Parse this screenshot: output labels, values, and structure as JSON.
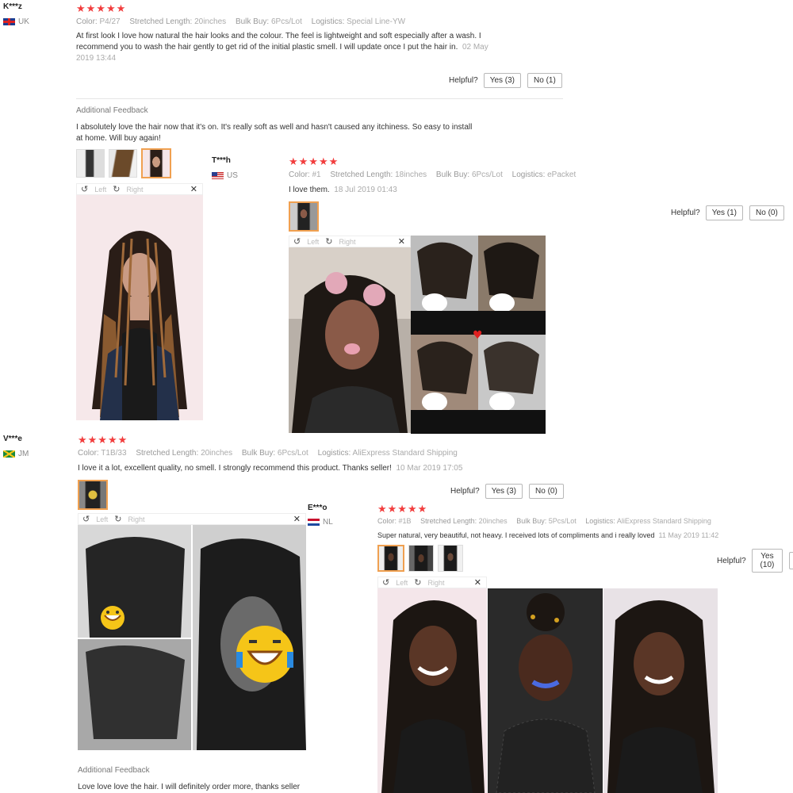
{
  "labels": {
    "color": "Color:",
    "length": "Stretched Length:",
    "bulk": "Bulk Buy:",
    "logistics": "Logistics:",
    "helpful": "Helpful?",
    "left": "Left",
    "right": "Right",
    "additional_feedback": "Additional Feedback"
  },
  "icons": [
    "star-icon",
    "rotate-left-icon",
    "rotate-right-icon",
    "close-icon",
    "flag-icon"
  ],
  "reviews": [
    {
      "user": "K***z",
      "country": "UK",
      "stars": "★★★★★",
      "color": "P4/27",
      "length": "20inches",
      "bulk": "6Pcs/Lot",
      "logistics": "Special Line-YW",
      "text_line1": "At first look I love how natural the hair looks and the colour. The feel is lightweight and soft especially after a wash. I",
      "text_line2": "recommend you to wash the hair gently to get rid of the initial plastic smell. I will update once I put the hair in.",
      "date_part1": "02 May",
      "date_part2": "2019 13:44",
      "yes": "Yes (3)",
      "no": "No (1)",
      "additional_line1": "I absolutely love the hair now that it's on. It's really soft as well and hasn't caused any itchiness. So easy to install",
      "additional_line2": "at home. Will buy again!"
    },
    {
      "user": "T***h",
      "country": "US",
      "stars": "★★★★★",
      "color": "#1",
      "length": "18inches",
      "bulk": "6Pcs/Lot",
      "logistics": "ePacket",
      "text": "I love them.",
      "date": "18 Jul 2019 01:43",
      "yes": "Yes (1)",
      "no": "No (0)"
    },
    {
      "user": "V***e",
      "country": "JM",
      "stars": "★★★★★",
      "color": "T1B/33",
      "length": "20inches",
      "bulk": "6Pcs/Lot",
      "logistics": "AliExpress Standard Shipping",
      "text": "I love it a lot, excellent quality, no smell. I strongly recommend this product. Thanks seller!",
      "date": "10 Mar 2019 17:05",
      "yes": "Yes (3)",
      "no": "No (0)",
      "additional": "Love love love the hair. I will definitely order more, thanks seller"
    },
    {
      "user": "E***o",
      "country": "NL",
      "stars": "★★★★★",
      "color": "#1B",
      "length": "20inches",
      "bulk": "5Pcs/Lot",
      "logistics": "AliExpress Standard Shipping",
      "text": "Super natural, very beautiful, not heavy. I received lots of compliments and i really loved",
      "date": "11 May 2019 11:42",
      "yes": "Yes (10)"
    }
  ],
  "colors": {
    "star": "#f23d3d",
    "selected_thumb": "#f0a050"
  }
}
